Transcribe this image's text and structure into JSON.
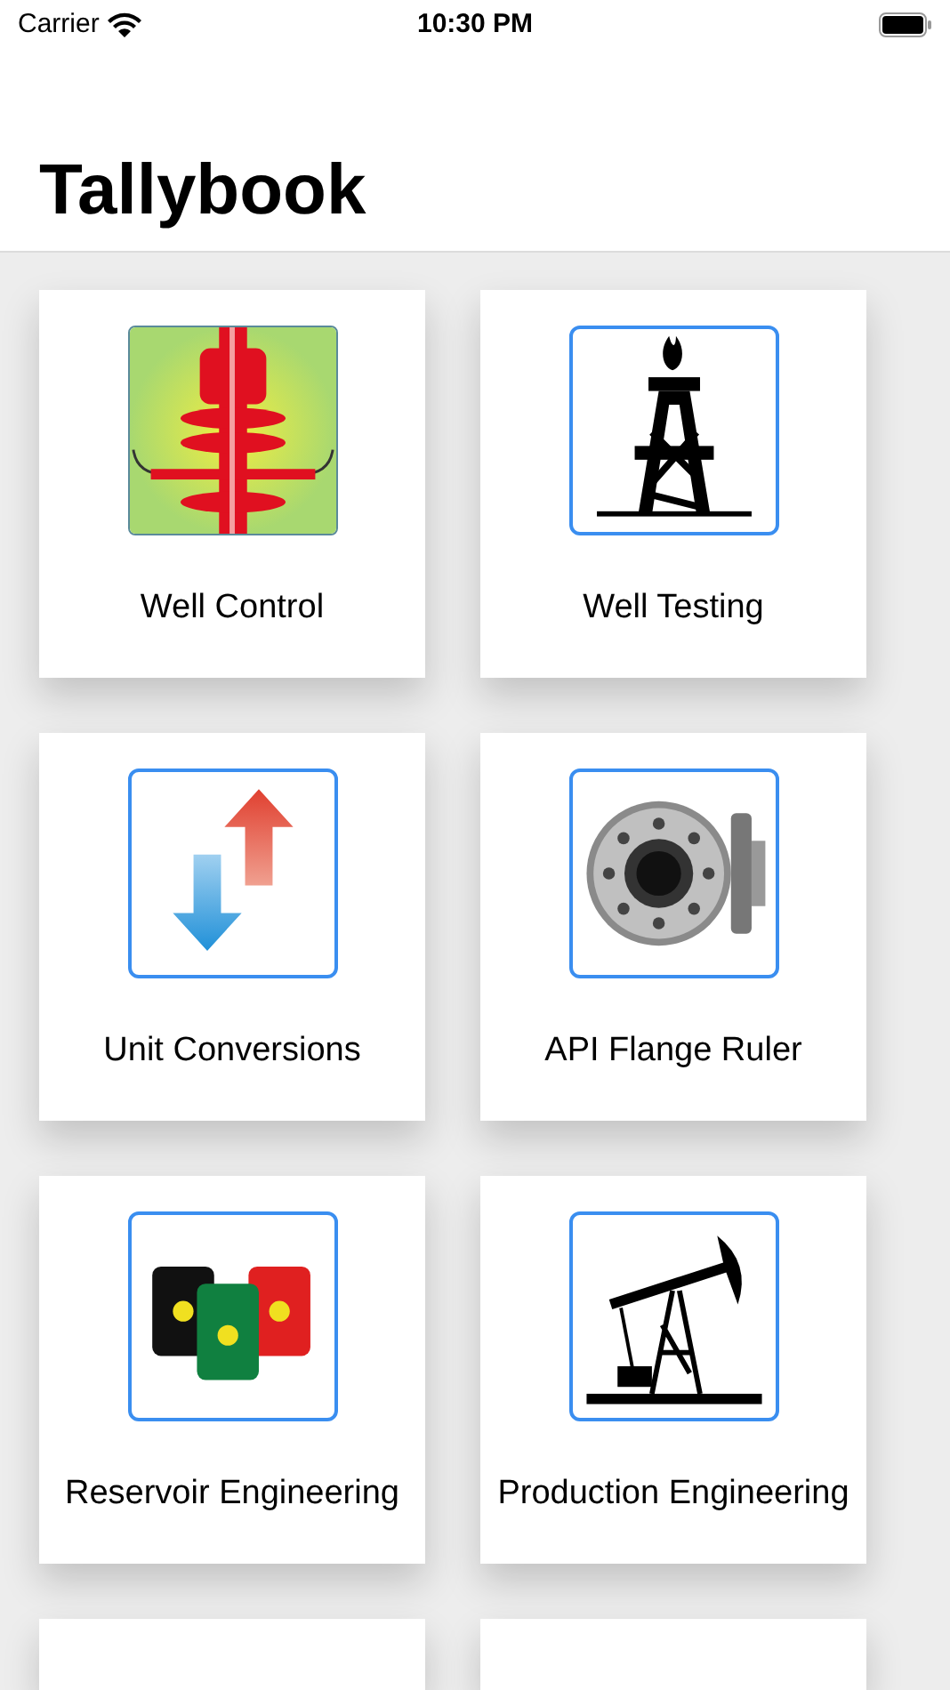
{
  "status_bar": {
    "carrier": "Carrier",
    "time": "10:30 PM"
  },
  "title": "Tallybook",
  "tiles": [
    {
      "label": "Well Control"
    },
    {
      "label": "Well Testing"
    },
    {
      "label": "Unit Conversions"
    },
    {
      "label": "API Flange Ruler"
    },
    {
      "label": "Reservoir Engineering"
    },
    {
      "label": "Production Engineering"
    }
  ]
}
